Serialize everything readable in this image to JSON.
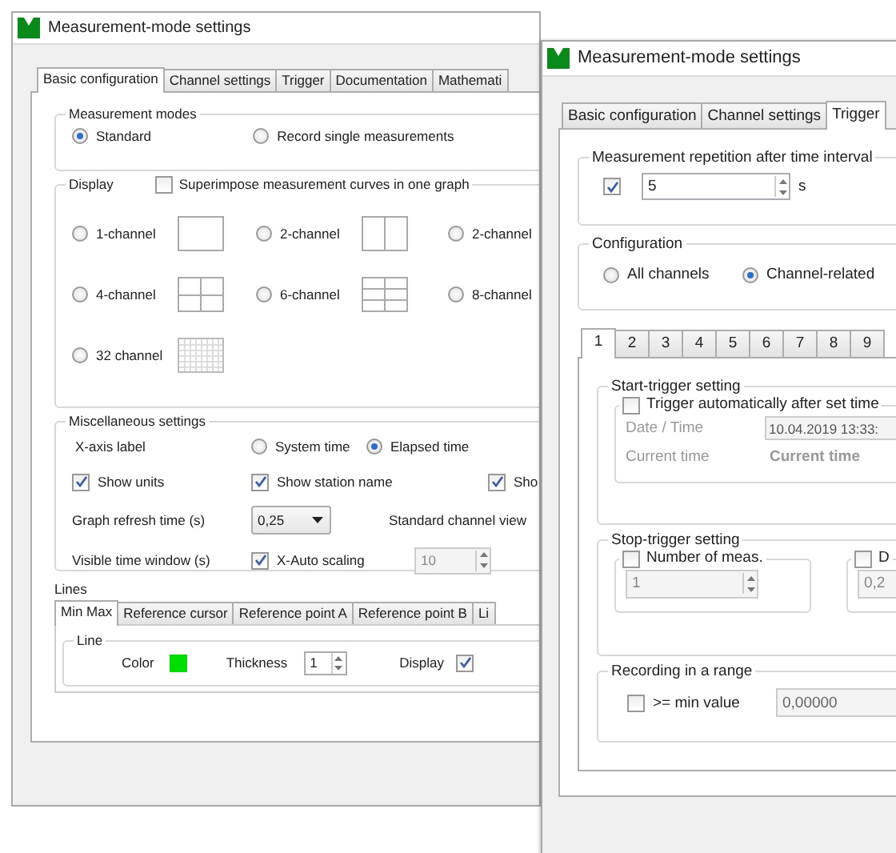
{
  "basic_window": {
    "title": "Measurement-mode settings",
    "tabs": [
      {
        "label": "Basic configuration",
        "selected": true
      },
      {
        "label": "Channel settings",
        "selected": false
      },
      {
        "label": "Trigger",
        "selected": false
      },
      {
        "label": "Documentation",
        "selected": false
      },
      {
        "label": "Mathemati",
        "selected": false
      }
    ],
    "measurement_modes": {
      "title": "Measurement modes",
      "options": [
        {
          "label": "Standard",
          "selected": true
        },
        {
          "label": "Record single measurements",
          "selected": false
        }
      ]
    },
    "display": {
      "title": "Display",
      "superimpose": {
        "label": "Superimpose measurement curves in one graph",
        "checked": false
      },
      "layouts": [
        {
          "label": "1-channel",
          "selected": false
        },
        {
          "label": "2-channel",
          "selected": false
        },
        {
          "label": "2-channel",
          "selected": false
        },
        {
          "label": "4-channel",
          "selected": false
        },
        {
          "label": "6-channel",
          "selected": false
        },
        {
          "label": "8-channel",
          "selected": false
        },
        {
          "label": "32 channel",
          "selected": false
        }
      ]
    },
    "misc": {
      "title": "Miscellaneous settings",
      "x_axis_label": "X-axis label",
      "x_axis_options": [
        {
          "label": "System time",
          "selected": false
        },
        {
          "label": "Elapsed time",
          "selected": true
        }
      ],
      "checks": [
        {
          "label": "Show units",
          "checked": true
        },
        {
          "label": "Show station name",
          "checked": true
        },
        {
          "label": "Sho",
          "checked": true
        }
      ],
      "refresh_label": "Graph refresh time (s)",
      "refresh_value": "0,25",
      "channel_view_label": "Standard channel view",
      "window_label": "Visible time window (s)",
      "auto_scaling": {
        "label": "X-Auto scaling",
        "checked": true
      },
      "window_value": "10"
    },
    "lines": {
      "title": "Lines",
      "tabs": [
        {
          "label": "Min Max",
          "selected": true
        },
        {
          "label": "Reference cursor",
          "selected": false
        },
        {
          "label": "Reference point A",
          "selected": false
        },
        {
          "label": "Reference point B",
          "selected": false
        },
        {
          "label": "Li",
          "selected": false
        }
      ],
      "group_title": "Line",
      "color_label": "Color",
      "color": "#00dd00",
      "thickness_label": "Thickness",
      "thickness": "1",
      "display_label": "Display",
      "display_checked": true
    }
  },
  "trigger_window": {
    "title": "Measurement-mode settings",
    "tabs": [
      {
        "label": "Basic configuration",
        "selected": false
      },
      {
        "label": "Channel settings",
        "selected": false
      },
      {
        "label": "Trigger",
        "selected": true
      }
    ],
    "repetition": {
      "title": "Measurement repetition after time interval",
      "checked": true,
      "value": "5",
      "unit": "s"
    },
    "configuration": {
      "title": "Configuration",
      "options": [
        {
          "label": "All channels",
          "selected": false
        },
        {
          "label": "Channel-related",
          "selected": true
        }
      ]
    },
    "channel_tabs": [
      {
        "label": "1",
        "selected": true
      },
      {
        "label": "2",
        "selected": false
      },
      {
        "label": "3",
        "selected": false
      },
      {
        "label": "4",
        "selected": false
      },
      {
        "label": "5",
        "selected": false
      },
      {
        "label": "6",
        "selected": false
      },
      {
        "label": "7",
        "selected": false
      },
      {
        "label": "8",
        "selected": false
      },
      {
        "label": "9",
        "selected": false
      }
    ],
    "start_trigger": {
      "title": "Start-trigger setting",
      "auto": {
        "label": "Trigger automatically after set time",
        "checked": false
      },
      "date_label": "Date / Time",
      "date_value": "10.04.2019 13:33:",
      "current_label": "Current time",
      "current_value": "Current time"
    },
    "stop_trigger": {
      "title": "Stop-trigger setting",
      "count": {
        "label": "Number of meas.",
        "checked": false,
        "value": "1"
      },
      "second": {
        "label": "D",
        "checked": false,
        "value": "0,2"
      }
    },
    "range": {
      "title": "Recording in a range",
      "check": {
        "label": ">= min value",
        "checked": false
      },
      "value": "0,00000"
    }
  }
}
